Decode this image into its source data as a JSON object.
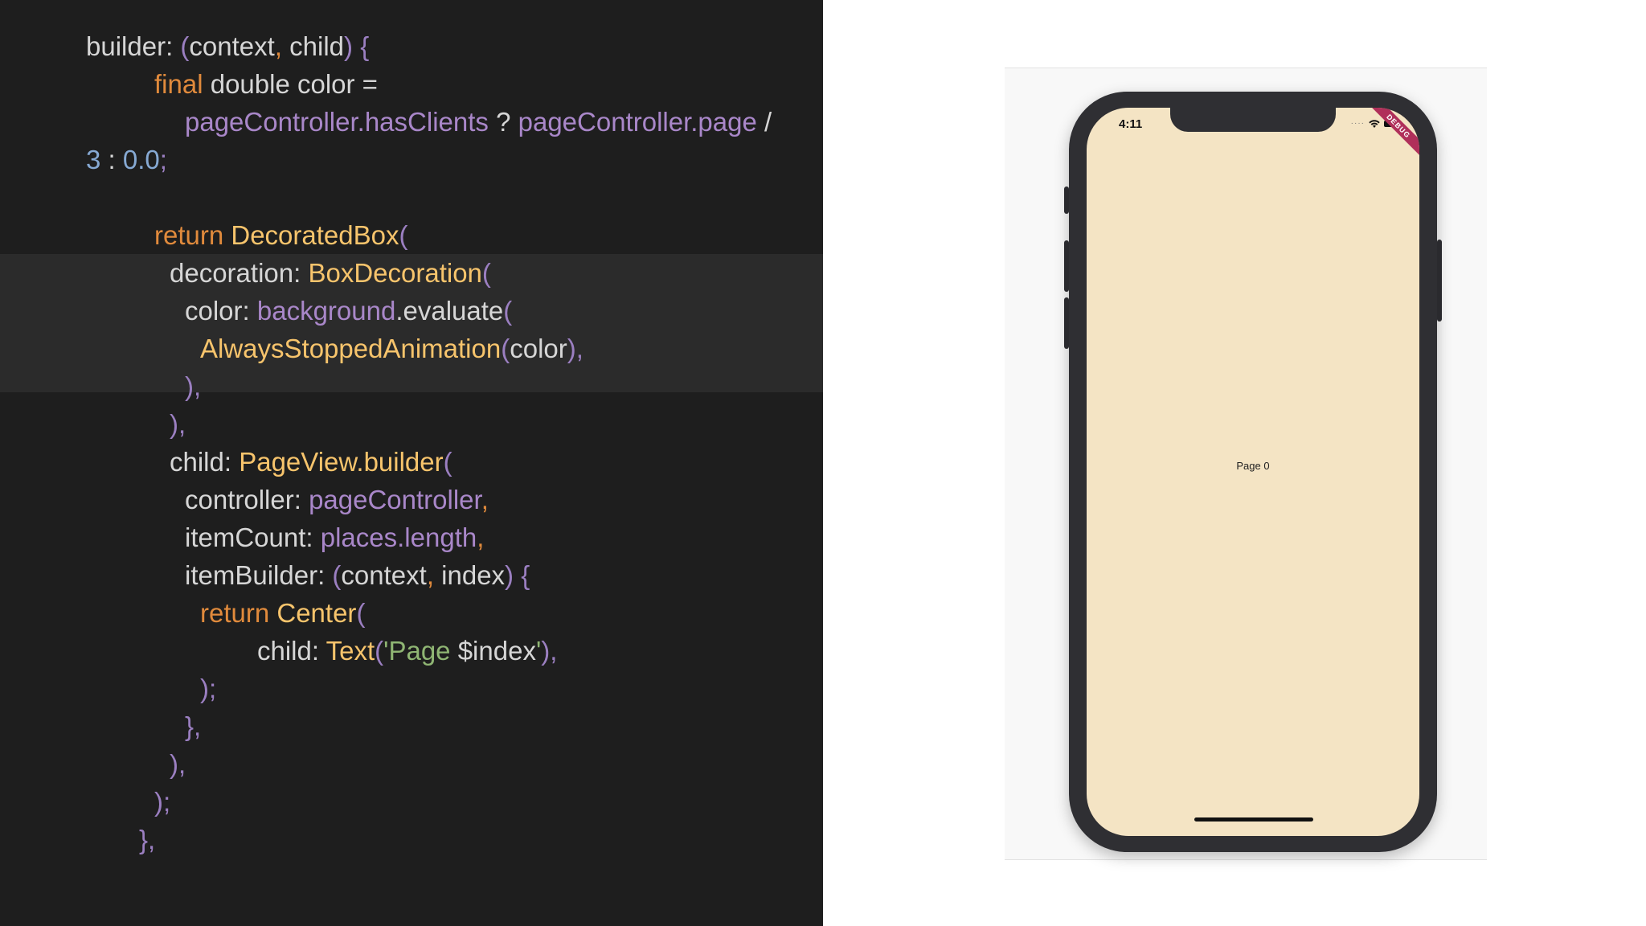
{
  "code": {
    "lines": [
      [
        {
          "t": "builder: ",
          "c": "plain"
        },
        {
          "t": "(",
          "c": "punc"
        },
        {
          "t": "context",
          "c": "plain"
        },
        {
          "t": ", ",
          "c": "orange"
        },
        {
          "t": "child",
          "c": "plain"
        },
        {
          "t": ") {",
          "c": "punc"
        }
      ],
      [
        {
          "t": "final",
          "c": "orange"
        },
        {
          "t": " double color =",
          "c": "plain"
        }
      ],
      [
        {
          "t": "pageController",
          "c": "purple"
        },
        {
          "t": ".hasClients",
          "c": "purple"
        },
        {
          "t": " ? ",
          "c": "plain"
        },
        {
          "t": "pageController",
          "c": "purple"
        },
        {
          "t": ".page",
          "c": "purple"
        },
        {
          "t": " /",
          "c": "plain"
        }
      ],
      [
        {
          "t": "3",
          "c": "blue"
        },
        {
          "t": " : ",
          "c": "plain"
        },
        {
          "t": "0.0",
          "c": "blue"
        },
        {
          "t": ";",
          "c": "punc"
        }
      ],
      [],
      [
        {
          "t": "return ",
          "c": "orange"
        },
        {
          "t": "DecoratedBox",
          "c": "yellow"
        },
        {
          "t": "(",
          "c": "punc"
        }
      ],
      [
        {
          "t": "decoration: ",
          "c": "plain"
        },
        {
          "t": "BoxDecoration",
          "c": "yellow"
        },
        {
          "t": "(",
          "c": "punc"
        }
      ],
      [
        {
          "t": "color: ",
          "c": "plain"
        },
        {
          "t": "background",
          "c": "purple"
        },
        {
          "t": ".evaluate",
          "c": "plain"
        },
        {
          "t": "(",
          "c": "punc"
        }
      ],
      [
        {
          "t": "AlwaysStoppedAnimation",
          "c": "yellow"
        },
        {
          "t": "(",
          "c": "punc"
        },
        {
          "t": "color",
          "c": "plain"
        },
        {
          "t": "),",
          "c": "punc"
        }
      ],
      [
        {
          "t": "),",
          "c": "punc"
        }
      ],
      [
        {
          "t": "),",
          "c": "punc"
        }
      ],
      [
        {
          "t": "child: ",
          "c": "plain"
        },
        {
          "t": "PageView.builder",
          "c": "yellow"
        },
        {
          "t": "(",
          "c": "punc"
        }
      ],
      [
        {
          "t": "controller: ",
          "c": "plain"
        },
        {
          "t": "pageController",
          "c": "purple"
        },
        {
          "t": ",",
          "c": "orange"
        }
      ],
      [
        {
          "t": "itemCount: ",
          "c": "plain"
        },
        {
          "t": "places",
          "c": "purple"
        },
        {
          "t": ".length",
          "c": "purple"
        },
        {
          "t": ",",
          "c": "orange"
        }
      ],
      [
        {
          "t": "itemBuilder: ",
          "c": "plain"
        },
        {
          "t": "(",
          "c": "punc"
        },
        {
          "t": "context",
          "c": "plain"
        },
        {
          "t": ", ",
          "c": "orange"
        },
        {
          "t": "index",
          "c": "plain"
        },
        {
          "t": ") {",
          "c": "punc"
        }
      ],
      [
        {
          "t": "return ",
          "c": "orange"
        },
        {
          "t": "Center",
          "c": "yellow"
        },
        {
          "t": "(",
          "c": "punc"
        }
      ],
      [
        {
          "t": "child: ",
          "c": "plain"
        },
        {
          "t": "Text",
          "c": "yellow"
        },
        {
          "t": "(",
          "c": "punc"
        },
        {
          "t": "'Page ",
          "c": "green"
        },
        {
          "t": "$index",
          "c": "plain"
        },
        {
          "t": "'",
          "c": "green"
        },
        {
          "t": "),",
          "c": "punc"
        }
      ],
      [
        {
          "t": ");",
          "c": "punc"
        }
      ],
      [
        {
          "t": "},",
          "c": "punc"
        }
      ],
      [
        {
          "t": "),",
          "c": "punc"
        }
      ],
      [
        {
          "t": ");",
          "c": "punc"
        }
      ],
      [
        {
          "t": "},",
          "c": "punc"
        }
      ]
    ]
  },
  "preview": {
    "status_time": "4:11",
    "debug_banner": "DEBUG",
    "page_text": "Page 0",
    "wifi_icon": "wifi-icon",
    "battery_icon": "battery-icon",
    "screen_color": "#f4e4c4"
  }
}
